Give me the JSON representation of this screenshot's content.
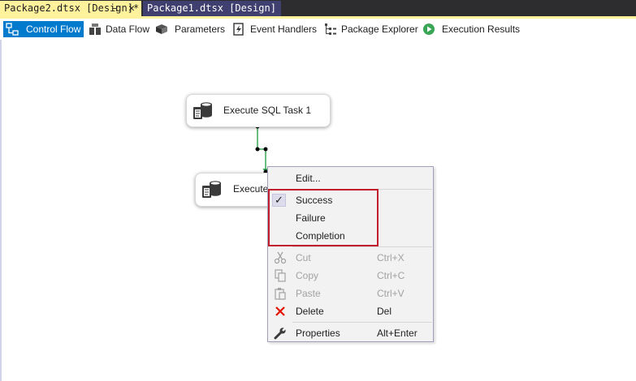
{
  "tabs": {
    "active": "Package2.dtsx [Design]*",
    "inactive": "Package1.dtsx [Design]",
    "pin_glyph": "⊣",
    "close_glyph": "✕"
  },
  "toolbar": {
    "control_flow": "Control Flow",
    "data_flow": "Data Flow",
    "parameters": "Parameters",
    "event_handlers": "Event Handlers",
    "package_explorer": "Package Explorer",
    "execution_results": "Execution Results"
  },
  "tasks": {
    "task1": "Execute SQL Task 1",
    "task2": "Execute"
  },
  "context_menu": {
    "edit": "Edit...",
    "checkmark": "✓",
    "success": "Success",
    "failure": "Failure",
    "completion": "Completion",
    "cut": "Cut",
    "cut_key": "Ctrl+X",
    "copy": "Copy",
    "copy_key": "Ctrl+C",
    "paste": "Paste",
    "paste_key": "Ctrl+V",
    "delete": "Delete",
    "delete_key": "Del",
    "properties": "Properties",
    "properties_key": "Alt+Enter"
  },
  "colors": {
    "active_tab": "#fff29d",
    "selected_tool": "#007acc",
    "precedence_success": "#3aa655",
    "highlight": "#c11f2e",
    "delete_icon": "#e51400"
  }
}
